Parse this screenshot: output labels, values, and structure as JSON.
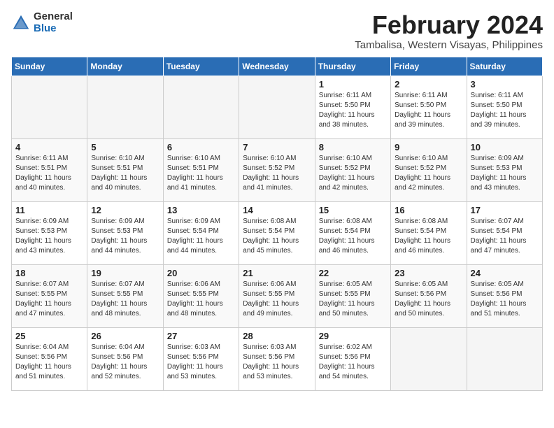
{
  "logo": {
    "general": "General",
    "blue": "Blue"
  },
  "title": {
    "month_year": "February 2024",
    "location": "Tambalisa, Western Visayas, Philippines"
  },
  "headers": [
    "Sunday",
    "Monday",
    "Tuesday",
    "Wednesday",
    "Thursday",
    "Friday",
    "Saturday"
  ],
  "weeks": [
    [
      {
        "day": "",
        "info": ""
      },
      {
        "day": "",
        "info": ""
      },
      {
        "day": "",
        "info": ""
      },
      {
        "day": "",
        "info": ""
      },
      {
        "day": "1",
        "info": "Sunrise: 6:11 AM\nSunset: 5:50 PM\nDaylight: 11 hours\nand 38 minutes."
      },
      {
        "day": "2",
        "info": "Sunrise: 6:11 AM\nSunset: 5:50 PM\nDaylight: 11 hours\nand 39 minutes."
      },
      {
        "day": "3",
        "info": "Sunrise: 6:11 AM\nSunset: 5:50 PM\nDaylight: 11 hours\nand 39 minutes."
      }
    ],
    [
      {
        "day": "4",
        "info": "Sunrise: 6:11 AM\nSunset: 5:51 PM\nDaylight: 11 hours\nand 40 minutes."
      },
      {
        "day": "5",
        "info": "Sunrise: 6:10 AM\nSunset: 5:51 PM\nDaylight: 11 hours\nand 40 minutes."
      },
      {
        "day": "6",
        "info": "Sunrise: 6:10 AM\nSunset: 5:51 PM\nDaylight: 11 hours\nand 41 minutes."
      },
      {
        "day": "7",
        "info": "Sunrise: 6:10 AM\nSunset: 5:52 PM\nDaylight: 11 hours\nand 41 minutes."
      },
      {
        "day": "8",
        "info": "Sunrise: 6:10 AM\nSunset: 5:52 PM\nDaylight: 11 hours\nand 42 minutes."
      },
      {
        "day": "9",
        "info": "Sunrise: 6:10 AM\nSunset: 5:52 PM\nDaylight: 11 hours\nand 42 minutes."
      },
      {
        "day": "10",
        "info": "Sunrise: 6:09 AM\nSunset: 5:53 PM\nDaylight: 11 hours\nand 43 minutes."
      }
    ],
    [
      {
        "day": "11",
        "info": "Sunrise: 6:09 AM\nSunset: 5:53 PM\nDaylight: 11 hours\nand 43 minutes."
      },
      {
        "day": "12",
        "info": "Sunrise: 6:09 AM\nSunset: 5:53 PM\nDaylight: 11 hours\nand 44 minutes."
      },
      {
        "day": "13",
        "info": "Sunrise: 6:09 AM\nSunset: 5:54 PM\nDaylight: 11 hours\nand 44 minutes."
      },
      {
        "day": "14",
        "info": "Sunrise: 6:08 AM\nSunset: 5:54 PM\nDaylight: 11 hours\nand 45 minutes."
      },
      {
        "day": "15",
        "info": "Sunrise: 6:08 AM\nSunset: 5:54 PM\nDaylight: 11 hours\nand 46 minutes."
      },
      {
        "day": "16",
        "info": "Sunrise: 6:08 AM\nSunset: 5:54 PM\nDaylight: 11 hours\nand 46 minutes."
      },
      {
        "day": "17",
        "info": "Sunrise: 6:07 AM\nSunset: 5:54 PM\nDaylight: 11 hours\nand 47 minutes."
      }
    ],
    [
      {
        "day": "18",
        "info": "Sunrise: 6:07 AM\nSunset: 5:55 PM\nDaylight: 11 hours\nand 47 minutes."
      },
      {
        "day": "19",
        "info": "Sunrise: 6:07 AM\nSunset: 5:55 PM\nDaylight: 11 hours\nand 48 minutes."
      },
      {
        "day": "20",
        "info": "Sunrise: 6:06 AM\nSunset: 5:55 PM\nDaylight: 11 hours\nand 48 minutes."
      },
      {
        "day": "21",
        "info": "Sunrise: 6:06 AM\nSunset: 5:55 PM\nDaylight: 11 hours\nand 49 minutes."
      },
      {
        "day": "22",
        "info": "Sunrise: 6:05 AM\nSunset: 5:55 PM\nDaylight: 11 hours\nand 50 minutes."
      },
      {
        "day": "23",
        "info": "Sunrise: 6:05 AM\nSunset: 5:56 PM\nDaylight: 11 hours\nand 50 minutes."
      },
      {
        "day": "24",
        "info": "Sunrise: 6:05 AM\nSunset: 5:56 PM\nDaylight: 11 hours\nand 51 minutes."
      }
    ],
    [
      {
        "day": "25",
        "info": "Sunrise: 6:04 AM\nSunset: 5:56 PM\nDaylight: 11 hours\nand 51 minutes."
      },
      {
        "day": "26",
        "info": "Sunrise: 6:04 AM\nSunset: 5:56 PM\nDaylight: 11 hours\nand 52 minutes."
      },
      {
        "day": "27",
        "info": "Sunrise: 6:03 AM\nSunset: 5:56 PM\nDaylight: 11 hours\nand 53 minutes."
      },
      {
        "day": "28",
        "info": "Sunrise: 6:03 AM\nSunset: 5:56 PM\nDaylight: 11 hours\nand 53 minutes."
      },
      {
        "day": "29",
        "info": "Sunrise: 6:02 AM\nSunset: 5:56 PM\nDaylight: 11 hours\nand 54 minutes."
      },
      {
        "day": "",
        "info": ""
      },
      {
        "day": "",
        "info": ""
      }
    ]
  ]
}
